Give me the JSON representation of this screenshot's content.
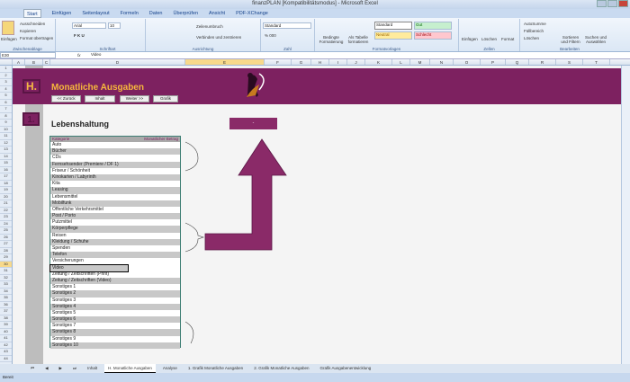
{
  "window": {
    "title": "finanzPLAN [Kompatibilitätsmodus] - Microsoft Excel"
  },
  "ribbon_tabs": [
    "Start",
    "Einfügen",
    "Seitenlayout",
    "Formeln",
    "Daten",
    "Überprüfen",
    "Ansicht",
    "PDF-XChange"
  ],
  "ribbon": {
    "paste": "Einfügen",
    "cut": "Ausschneiden",
    "copy": "Kopieren",
    "format_painter": "Format übertragen",
    "clipboard": "Zwischenablage",
    "font_name": "Arial",
    "font_size": "10",
    "font_group": "Schriftart",
    "wrap": "Zeilenumbruch",
    "merge": "Verbinden und zentrieren",
    "align_group": "Ausrichtung",
    "number_format": "Standard",
    "number_group": "Zahl",
    "cond_format": "Bedingte Formatierung",
    "as_table": "Als Tabelle formatieren",
    "styles": [
      "Standard",
      "Gut",
      "Neutral",
      "Schlecht"
    ],
    "styles_group": "Formatvorlagen",
    "insert": "Einfügen",
    "delete": "Löschen",
    "format": "Format",
    "cells_group": "Zellen",
    "autosum": "AutoSumme",
    "fill": "Füllbereich",
    "clear": "Löschen",
    "sort": "Sortieren und Filtern",
    "find": "Suchen und Auswählen",
    "edit_group": "Bearbeiten"
  },
  "formula_bar": {
    "cell_ref": "E30",
    "value": "Video"
  },
  "columns": [
    "A",
    "B",
    "C",
    "D",
    "E",
    "F",
    "G",
    "H",
    "I",
    "J",
    "K",
    "L",
    "M",
    "N",
    "O",
    "P",
    "Q",
    "R",
    "S",
    "T"
  ],
  "rows": [
    "1",
    "2",
    "3",
    "4",
    "5",
    "6",
    "7",
    "8",
    "9",
    "10",
    "11",
    "12",
    "13",
    "14",
    "15",
    "16",
    "17",
    "18",
    "19",
    "20",
    "21",
    "22",
    "23",
    "24",
    "25",
    "26",
    "27",
    "28",
    "29",
    "30",
    "31",
    "32",
    "33",
    "34",
    "35",
    "36",
    "37",
    "38",
    "39",
    "40",
    "41",
    "42",
    "43",
    "44"
  ],
  "sheet": {
    "h_badge": "H.",
    "title": "Monatliche Ausgaben",
    "nav": [
      "<< Zurück",
      "Inhalt",
      "Weiter >>",
      "Grafik"
    ],
    "section_badge": "1.",
    "section_title": "Lebenshaltung",
    "table_headers": [
      "Kategorie",
      "Monatlicher Betrag"
    ],
    "categories": [
      "Auto",
      "Bücher",
      "CDs",
      "Fernsehsender (Premiere / DF 1)",
      "Friseur / Schönheit",
      "Kinokarten / Labyrinth",
      "Kita",
      "Leasing",
      "Lebensmittel",
      "Mobilfunk",
      "Öffentliche Verkehrsmittel",
      "Post / Porto",
      "Putzmittel",
      "Körperpflege",
      "Reisen",
      "Kleidung / Schuhe",
      "Spenden",
      "Telefon",
      "Versicherungen",
      "Video",
      "Zeitung / Zeitschriften (Print)",
      "Zeitung / Zeitschriften (Video)",
      "Sonstiges 1",
      "Sonstiges 2",
      "Sonstiges 3",
      "Sonstiges 4",
      "Sonstiges 5",
      "Sonstiges 6",
      "Sonstiges 7",
      "Sonstiges 8",
      "Sonstiges 9",
      "Sonstiges 10"
    ],
    "selected_index": 19,
    "purple_button": "-"
  },
  "sheet_tabs": [
    "Inhalt",
    "H. Monatliche Ausgaben",
    "Analyse",
    "1. Grafik Monatliche Ausgaben",
    "2. Grafik Monatliche Ausgaben",
    "Grafik Ausgabenentwicklung"
  ],
  "active_sheet_tab": 1,
  "status": "Bereit",
  "colors": {
    "brand": "#7d2160",
    "accent": "#f6b73c"
  }
}
